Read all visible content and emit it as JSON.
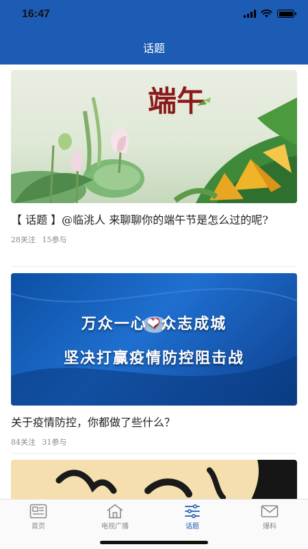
{
  "status_bar": {
    "time": "16:47"
  },
  "header": {
    "title": "话题"
  },
  "feed": [
    {
      "image": {
        "overlay_text": "端午"
      },
      "title": "【 话题 】@临洮人  来聊聊你的端午节是怎么过的呢?",
      "follow": "28关注",
      "join": "15参与"
    },
    {
      "image": {
        "line1": "万众一心❤众志成城",
        "line2": "坚决打赢疫情防控阻击战"
      },
      "title": "关于疫情防控，你都做了些什么？",
      "follow": "84关注",
      "join": "31参与"
    }
  ],
  "tabbar": {
    "active": "话题",
    "tabs": [
      {
        "label": "首页",
        "icon": "newspaper-icon"
      },
      {
        "label": "电视广播",
        "icon": "home-icon"
      },
      {
        "label": "话题",
        "icon": "topic-list-icon"
      },
      {
        "label": "爆料",
        "icon": "mail-icon"
      }
    ]
  },
  "colors": {
    "brand": "#1d5cb4",
    "muted": "#888888",
    "tab_inactive": "#888888"
  }
}
